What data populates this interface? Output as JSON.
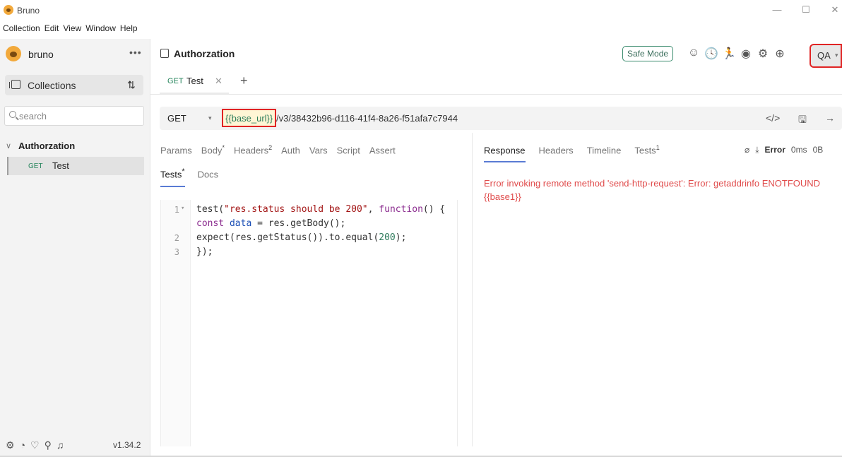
{
  "window": {
    "title": "Bruno",
    "controls": [
      "—",
      "☐",
      "✕"
    ]
  },
  "menubar": [
    "Collection",
    "Edit",
    "View",
    "Window",
    "Help"
  ],
  "sidebar": {
    "workspace_name": "bruno",
    "more_label": "•••",
    "collections_label": "Collections",
    "sort_icon": "⇅",
    "search_placeholder": "search",
    "collection_name": "Authorzation",
    "collection_chevron": "∨",
    "request": {
      "method": "GET",
      "name": "Test"
    },
    "footer_icons": [
      "⚙",
      "◔",
      "♡",
      "⚲",
      "♫"
    ],
    "version": "v1.34.2"
  },
  "header": {
    "collection_title": "Authorzation",
    "safe_mode_label": "Safe Mode",
    "icons": [
      "☺",
      "🕓",
      "🏃",
      "◉",
      "⚙",
      "⊕"
    ],
    "environment": "QA",
    "env_caret": "▾"
  },
  "tabs": {
    "items": [
      {
        "method": "GET",
        "label": "Test",
        "close": "✕"
      }
    ],
    "new_tab": "+"
  },
  "url_bar": {
    "method": "GET",
    "method_caret": "▾",
    "variable": "{{base_url}}",
    "path": "/v3/38432b96-d116-41f4-8a26-f51afa7c7944",
    "actions": [
      "</>",
      "🖫",
      "→"
    ]
  },
  "request_pane": {
    "tabs": [
      {
        "label": "Params",
        "sup": ""
      },
      {
        "label": "Body",
        "sup": "*"
      },
      {
        "label": "Headers",
        "sup": "2"
      },
      {
        "label": "Auth",
        "sup": ""
      },
      {
        "label": "Vars",
        "sup": ""
      },
      {
        "label": "Script",
        "sup": ""
      },
      {
        "label": "Assert",
        "sup": ""
      }
    ],
    "tabs_row2": [
      {
        "label": "Tests",
        "sup": "*",
        "active": true
      },
      {
        "label": "Docs",
        "sup": "",
        "active": false
      }
    ],
    "code": [
      {
        "ln": "1",
        "fold": "▾",
        "text": "test(\"res.status should be 200\", function() {"
      },
      {
        "ln": "",
        "fold": "",
        "text": "const data = res.getBody();"
      },
      {
        "ln": "2",
        "fold": "",
        "text": "expect(res.getStatus()).to.equal(200);"
      },
      {
        "ln": "3",
        "fold": "",
        "text": "});"
      }
    ]
  },
  "response_pane": {
    "tabs": [
      {
        "label": "Response",
        "sup": "",
        "active": true
      },
      {
        "label": "Headers",
        "sup": "",
        "active": false
      },
      {
        "label": "Timeline",
        "sup": "",
        "active": false
      },
      {
        "label": "Tests",
        "sup": "1",
        "active": false
      }
    ],
    "clear_icon": "⌀",
    "download_icon": "⤓",
    "status": "Error",
    "time": "0ms",
    "size": "0B",
    "error_message": "Error invoking remote method 'send-http-request': Error: getaddrinfo ENOTFOUND {{base1}}"
  }
}
